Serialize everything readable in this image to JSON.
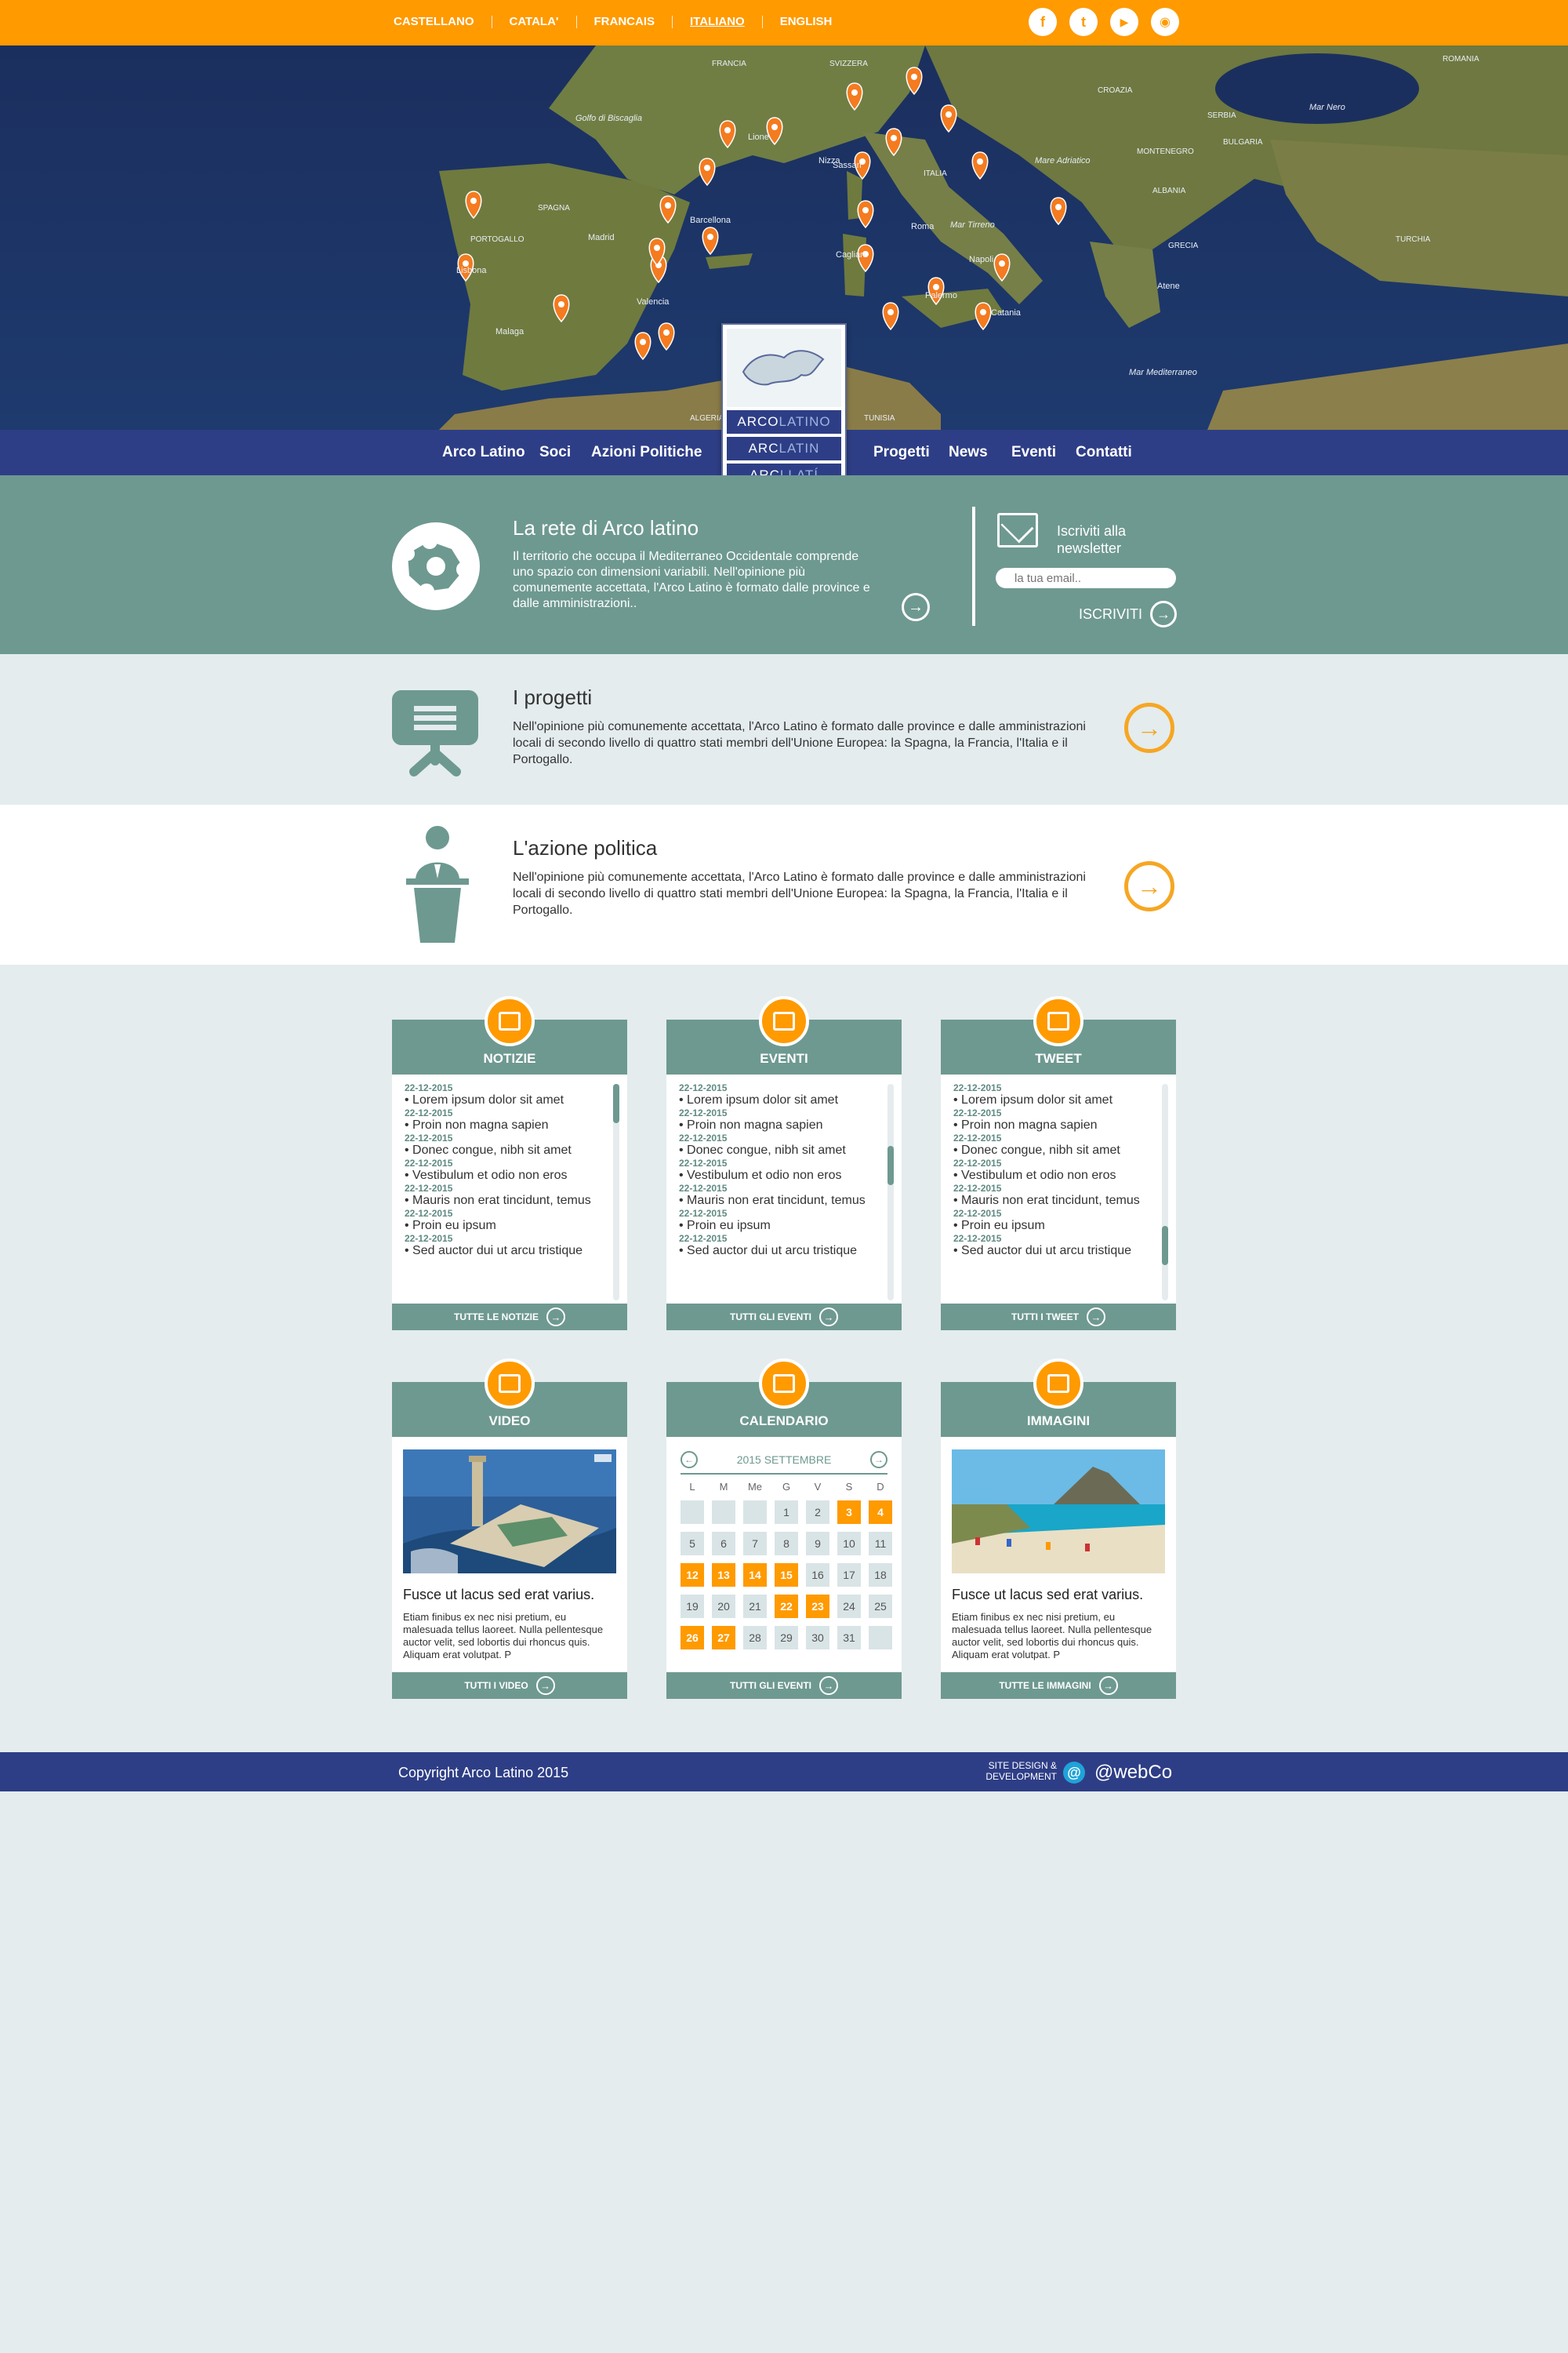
{
  "languages": [
    "CASTELLANO",
    "CATALA'",
    "FRANCAIS",
    "ITALIANO",
    "ENGLISH"
  ],
  "active_language": "ITALIANO",
  "social": [
    "facebook-icon",
    "twitter-icon",
    "youtube-icon",
    "rss-icon"
  ],
  "nav": {
    "left": [
      "Arco Latino",
      "Soci",
      "Azioni Politiche"
    ],
    "right": [
      "Progetti",
      "News",
      "Eventi",
      "Contatti"
    ]
  },
  "logo": {
    "rows": [
      {
        "a": "ARCO",
        "b": "LATINO"
      },
      {
        "a": "ARC",
        "b": "LATIN"
      },
      {
        "a": "ARC",
        "b": "LLATÍ"
      }
    ]
  },
  "map": {
    "labels": [
      "Golfo di Biscaglia",
      "FRANCIA",
      "SVIZZERA",
      "ITALIA",
      "SPAGNA",
      "PORTOGALLO",
      "ROMANIA",
      "Mar Nero",
      "BULGARIA",
      "SERBIA",
      "CROAZIA",
      "GRECIA",
      "TURCHIA",
      "Mar Tirreno",
      "Mar Mediterraneo",
      "Mare Adriatico",
      "TUNISIA",
      "ALGERIA",
      "MONTENEGRO",
      "ALBANIA",
      "Madrid",
      "Lisbona",
      "Barcellona",
      "Valencia",
      "Roma",
      "Napoli",
      "Atene",
      "Malaga",
      "Sassari",
      "Cagliari",
      "Palermo",
      "Catania",
      "Lione",
      "Nizza"
    ]
  },
  "rete": {
    "title": "La rete di Arco latino",
    "text": "Il territorio che occupa il Mediterraneo Occidentale comprende uno spazio con dimensioni variabili. Nell'opinione più comunemente accettata, l'Arco Latino è formato dalle province e dalle amministrazioni.."
  },
  "newsletter": {
    "title": "Iscriviti alla newsletter",
    "placeholder": "la tua email..",
    "button": "ISCRIVITI"
  },
  "progetti": {
    "title": "I progetti",
    "text": "Nell'opinione più comunemente accettata, l'Arco Latino è formato dalle province e dalle amministrazioni locali di secondo livello di quattro stati membri dell'Unione Europea: la Spagna, la Francia, l'Italia e il Portogallo."
  },
  "azione": {
    "title": "L'azione politica",
    "text": "Nell'opinione più comunemente accettata, l'Arco Latino è formato dalle province e dalle amministrazioni locali di secondo livello di quattro stati membri dell'Unione Europea: la Spagna, la Francia, l'Italia e il Portogallo."
  },
  "feeds": [
    {
      "title": "NOTIZIE",
      "footer": "TUTTE LE NOTIZIE",
      "icon": "newspaper-icon",
      "thumb": 0.0
    },
    {
      "title": "EVENTI",
      "footer": "TUTTI GLI EVENTI",
      "icon": "megaphone-icon",
      "thumb": 0.35
    },
    {
      "title": "TWEET",
      "footer": "TUTTI I TWEET",
      "icon": "twitter-bird-icon",
      "thumb": 0.8
    }
  ],
  "feed_items": [
    {
      "date": "22-12-2015",
      "text": "• Lorem ipsum dolor sit amet"
    },
    {
      "date": "22-12-2015",
      "text": "• Proin non magna sapien"
    },
    {
      "date": "22-12-2015",
      "text": "• Donec congue, nibh sit amet"
    },
    {
      "date": "22-12-2015",
      "text": "• Vestibulum et odio non eros"
    },
    {
      "date": "22-12-2015",
      "text": "• Mauris non erat tincidunt, temus"
    },
    {
      "date": "22-12-2015",
      "text": "• Proin eu ipsum"
    },
    {
      "date": "22-12-2015",
      "text": "• Sed auctor dui ut arcu tristique"
    }
  ],
  "video": {
    "title": "VIDEO",
    "caption": "Fusce ut lacus sed erat varius.",
    "text": "Etiam finibus ex nec nisi pretium, eu malesuada tellus laoreet. Nulla pellentesque auctor velit, sed lobortis dui rhoncus quis. Aliquam erat volutpat. P",
    "footer": "TUTTI I VIDEO",
    "icon": "video-icon"
  },
  "calendar": {
    "title": "CALENDARIO",
    "month": "2015 SETTEMBRE",
    "weekdays": [
      "L",
      "M",
      "Me",
      "G",
      "V",
      "S",
      "D"
    ],
    "days": [
      "",
      "",
      "",
      "1",
      "2",
      "3",
      "4",
      "5",
      "6",
      "7",
      "8",
      "9",
      "10",
      "11",
      "12",
      "13",
      "14",
      "15",
      "16",
      "17",
      "18",
      "19",
      "20",
      "21",
      "22",
      "23",
      "24",
      "25",
      "26",
      "27",
      "28",
      "29",
      "30",
      "31",
      ""
    ],
    "highlighted": [
      "3",
      "4",
      "12",
      "13",
      "14",
      "15",
      "22",
      "23",
      "26",
      "27"
    ],
    "footer": "TUTTI GLI EVENTI",
    "icon": "calendar-icon"
  },
  "immagini": {
    "title": "IMMAGINI",
    "caption": "Fusce ut lacus sed erat varius.",
    "text": "Etiam finibus ex nec nisi pretium, eu malesuada tellus laoreet. Nulla pellentesque auctor velit, sed lobortis dui rhoncus quis. Aliquam erat volutpat. P",
    "footer": "TUTTE LE IMMAGINI",
    "icon": "image-icon"
  },
  "footer": {
    "copyright": "Copyright Arco Latino 2015",
    "credit_line1": "SITE DESIGN &",
    "credit_line2": "DEVELOPMENT",
    "at": "@",
    "brand": "@webCo"
  },
  "colors": {
    "orange": "#ff9a00",
    "navy": "#2e3e86",
    "teal": "#6e9990",
    "bg": "#e4ecee"
  }
}
